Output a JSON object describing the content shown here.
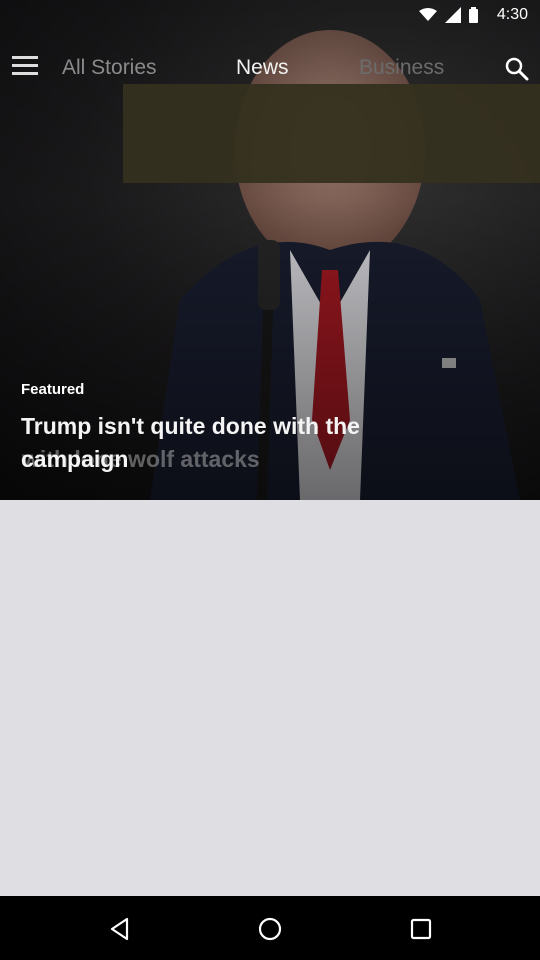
{
  "status_bar": {
    "time": "4:30",
    "icons": [
      "wifi-icon",
      "signal-icon",
      "battery-icon"
    ]
  },
  "top_nav": {
    "tabs": [
      {
        "label": "All Stories"
      },
      {
        "label": "News"
      },
      {
        "label": "Business"
      }
    ],
    "active_tab": "News",
    "icons": [
      "menu-icon",
      "search-icon"
    ]
  },
  "featured": {
    "label": "Featured",
    "headline": "Trump isn't quite done with the campaign",
    "ghost_headline_fragment": "with lone wolf attacks"
  },
  "nav_bar": {
    "icons": [
      "back-icon",
      "home-icon",
      "recents-icon"
    ]
  },
  "colors": {
    "accent_red": "#b01a24",
    "content_background": "#dfdfe3",
    "overlay_box": "#35301f"
  }
}
